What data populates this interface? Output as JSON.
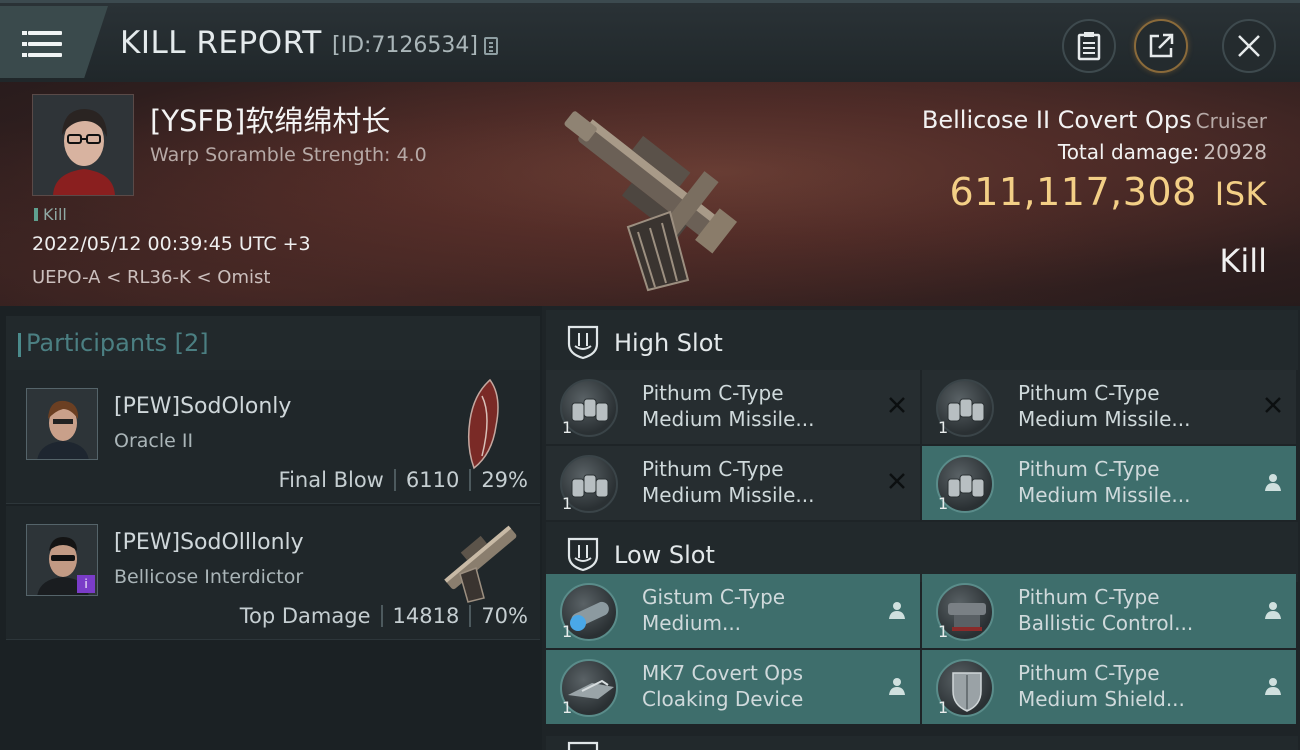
{
  "header": {
    "title": "KILL REPORT",
    "report_id": "[ID:7126534]"
  },
  "victim": {
    "name": "[YSFB]软绵绵村长",
    "warp_scramble": "Warp Soramble Strength: 4.0",
    "tag": "Kill",
    "datetime": "2022/05/12 00:39:45 UTC +3",
    "location": "UEPO-A < RL36-K < Omist"
  },
  "ship": {
    "name": "Bellicose II Covert Ops",
    "class": "Cruiser",
    "total_damage_label": "Total damage:",
    "total_damage": "20928",
    "isk_value": "611,117,308",
    "isk_unit": "ISK",
    "result": "Kill"
  },
  "participants": {
    "title": "Participants",
    "count": "[2]",
    "rows": [
      {
        "name": "[PEW]SodOlonly",
        "ship": "Oracle II",
        "role": "Final Blow",
        "damage": "6110",
        "percent": "29%"
      },
      {
        "name": "[PEW]SodOlllonly",
        "ship": "Bellicose Interdictor",
        "role": "Top Damage",
        "damage": "14818",
        "percent": "70%"
      }
    ]
  },
  "high_slot": {
    "label": "High Slot",
    "items": [
      {
        "line1": "Pithum C-Type",
        "line2": "Medium Missile...",
        "qty": "1",
        "state": "destroyed"
      },
      {
        "line1": "Pithum C-Type",
        "line2": "Medium Missile...",
        "qty": "1",
        "state": "destroyed"
      },
      {
        "line1": "Pithum C-Type",
        "line2": "Medium Missile...",
        "qty": "1",
        "state": "destroyed"
      },
      {
        "line1": "Pithum C-Type",
        "line2": "Medium Missile...",
        "qty": "1",
        "state": "dropped"
      }
    ]
  },
  "low_slot": {
    "label": "Low Slot",
    "items": [
      {
        "line1": "Gistum C-Type",
        "line2": "Medium...",
        "qty": "1",
        "state": "dropped"
      },
      {
        "line1": "Pithum C-Type",
        "line2": "Ballistic Control...",
        "qty": "1",
        "state": "dropped"
      },
      {
        "line1": "MK7 Covert Ops",
        "line2": "Cloaking Device",
        "qty": "1",
        "state": "dropped"
      },
      {
        "line1": "Pithum C-Type",
        "line2": "Medium Shield...",
        "qty": "1",
        "state": "dropped"
      }
    ]
  },
  "colors": {
    "accent_teal": "#3e6e6c",
    "isk_gold": "#f3cf86",
    "hero_red": "#4c2a26"
  }
}
